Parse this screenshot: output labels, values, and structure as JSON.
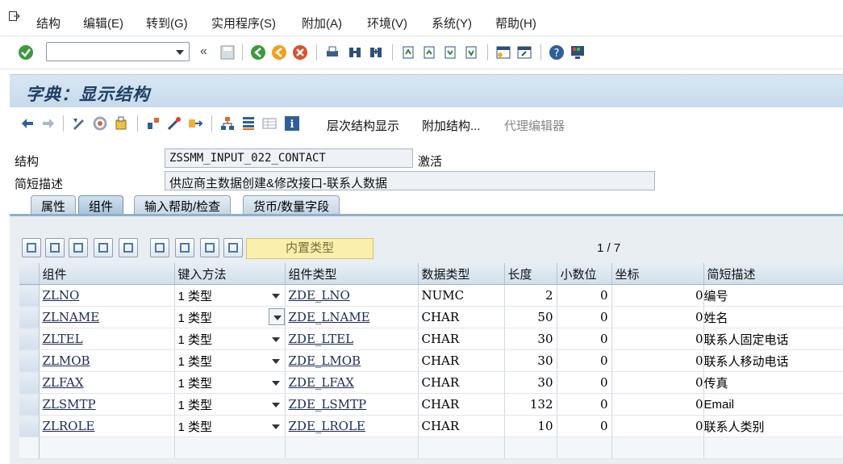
{
  "menu": {
    "items": [
      "结构",
      "编辑(E)",
      "转到(G)",
      "实用程序(S)",
      "附加(A)",
      "环境(V)",
      "系统(Y)",
      "帮助(H)"
    ]
  },
  "system_toolbar": {
    "command_field": "",
    "icons": [
      "enter-icon",
      "expand-icon",
      "save-icon",
      "back-icon",
      "exit-icon",
      "cancel-icon",
      "print-icon",
      "find-icon",
      "find-next-icon",
      "first-page-icon",
      "prev-page-icon",
      "next-page-icon",
      "last-page-icon",
      "new-session-icon",
      "shortcut-icon",
      "help-icon",
      "customize-layout-icon"
    ]
  },
  "title": "字典：显示结构",
  "app_toolbar": {
    "hierarchy_label": "层次结构显示",
    "append_label": "附加结构...",
    "proxy_label": "代理编辑器"
  },
  "header": {
    "structure_label": "结构",
    "structure_value": "ZSSMM_INPUT_022_CONTACT",
    "status": "激活",
    "desc_label": "简短描述",
    "desc_value": "供应商主数据创建&修改接口-联系人数据"
  },
  "tabs": [
    "属性",
    "组件",
    "输入帮助/检查",
    "货币/数量字段"
  ],
  "table_toolbar": {
    "builtin_type_label": "内置类型",
    "pager": "1  /  7"
  },
  "grid": {
    "columns": [
      "组件",
      "键入方法",
      "组件类型",
      "数据类型",
      "长度",
      "小数位",
      "坐标",
      "简短描述"
    ],
    "rows": [
      {
        "component": "ZLNO",
        "typing": "1 类型",
        "comp_type": "ZDE_LNO",
        "data_type": "NUMC",
        "length": "2",
        "decimals": "0",
        "coord": "0",
        "desc": "编号"
      },
      {
        "component": "ZLNAME",
        "typing": "1 类型",
        "comp_type": "ZDE_LNAME",
        "data_type": "CHAR",
        "length": "50",
        "decimals": "0",
        "coord": "0",
        "desc": "姓名"
      },
      {
        "component": "ZLTEL",
        "typing": "1 类型",
        "comp_type": "ZDE_LTEL",
        "data_type": "CHAR",
        "length": "30",
        "decimals": "0",
        "coord": "0",
        "desc": "联系人固定电话"
      },
      {
        "component": "ZLMOB",
        "typing": "1 类型",
        "comp_type": "ZDE_LMOB",
        "data_type": "CHAR",
        "length": "30",
        "decimals": "0",
        "coord": "0",
        "desc": "联系人移动电话"
      },
      {
        "component": "ZLFAX",
        "typing": "1 类型",
        "comp_type": "ZDE_LFAX",
        "data_type": "CHAR",
        "length": "30",
        "decimals": "0",
        "coord": "0",
        "desc": "传真"
      },
      {
        "component": "ZLSMTP",
        "typing": "1 类型",
        "comp_type": "ZDE_LSMTP",
        "data_type": "CHAR",
        "length": "132",
        "decimals": "0",
        "coord": "0",
        "desc": "Email"
      },
      {
        "component": "ZLROLE",
        "typing": "1 类型",
        "comp_type": "ZDE_LROLE",
        "data_type": "CHAR",
        "length": "10",
        "decimals": "0",
        "coord": "0",
        "desc": "联系人类别"
      }
    ]
  }
}
